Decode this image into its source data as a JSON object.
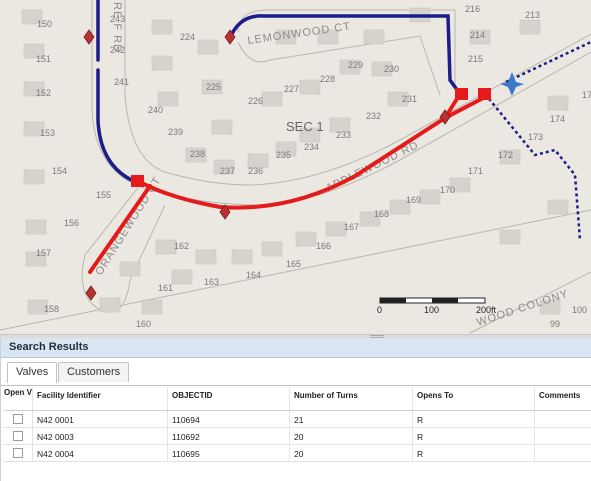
{
  "map": {
    "parcel_numbers": [
      "150",
      "243",
      "224",
      "216",
      "213",
      "151",
      "242",
      "214",
      "215",
      "152",
      "241",
      "225",
      "228",
      "229",
      "230",
      "17",
      "240",
      "227",
      "231",
      "153",
      "239",
      "226",
      "232",
      "174",
      "233",
      "234",
      "173",
      "238",
      "235",
      "172",
      "154",
      "237",
      "236",
      "171",
      "155",
      "170",
      "169",
      "156",
      "168",
      "167",
      "162",
      "166",
      "157",
      "165",
      "164",
      "163",
      "161",
      "158",
      "160",
      "100",
      "99"
    ],
    "streets": {
      "lemonwood": "LEMONWOOD CT",
      "applewood": "APPLEWOOD RD",
      "orangewood": "ORANGEWOOD CT",
      "top_left": "RE F RD",
      "colony": "WOOD COLONY"
    },
    "section_label": "SEC 1",
    "scale_bar": {
      "labels": [
        "0",
        "100",
        "200ft"
      ]
    },
    "colors": {
      "water_main": "#1c1c8a",
      "isolated_main": "#e51b1b",
      "valve_marker": "#b83232",
      "service_dotted": "#1c1c8a",
      "flow_marker": "#3d79c9"
    }
  },
  "results": {
    "title": "Search Results",
    "tabs": [
      {
        "label": "Valves",
        "active": true
      },
      {
        "label": "Customers",
        "active": false
      }
    ],
    "columns": [
      "Open Valve",
      "Facility Identifier",
      "OBJECTID",
      "Number of Turns",
      "Opens To",
      "Comments"
    ],
    "rows": [
      {
        "open_valve": false,
        "facility_id": "N42 0001",
        "objectid": "110694",
        "turns": "21",
        "opens_to": "R",
        "comments": ""
      },
      {
        "open_valve": false,
        "facility_id": "N42 0003",
        "objectid": "110692",
        "turns": "20",
        "opens_to": "R",
        "comments": ""
      },
      {
        "open_valve": false,
        "facility_id": "N42 0004",
        "objectid": "110695",
        "turns": "20",
        "opens_to": "R",
        "comments": ""
      }
    ]
  }
}
